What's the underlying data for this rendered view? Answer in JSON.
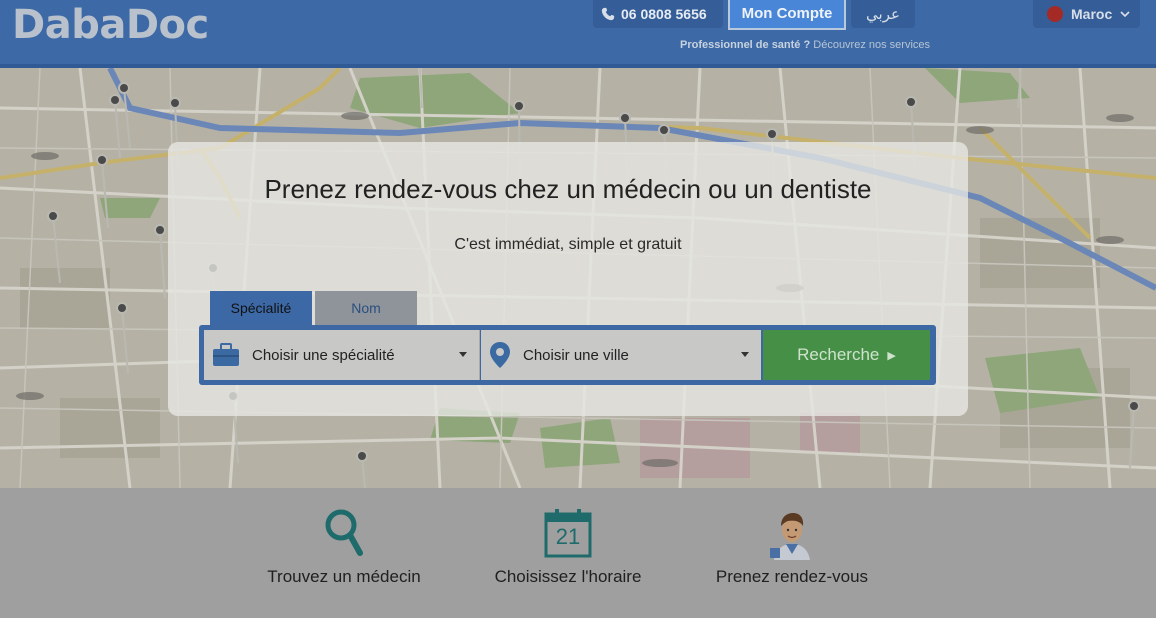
{
  "header": {
    "logo": "DabaDoc",
    "phone": "06 0808 5656",
    "account_label": "Mon Compte",
    "language_label": "عربي",
    "pro_bold": "Professionnel de santé ?",
    "pro_text": " Découvrez nos services",
    "country": "Maroc"
  },
  "hero": {
    "title": "Prenez rendez-vous chez un médecin ou un dentiste",
    "subtitle": "C'est immédiat, simple et gratuit"
  },
  "search": {
    "tabs": [
      {
        "label": "Spécialité",
        "active": true
      },
      {
        "label": "Nom",
        "active": false
      }
    ],
    "specialty_value": "Choisir une spécialité",
    "city_value": "Choisir une ville",
    "button_label": "Recherche"
  },
  "steps": [
    {
      "label": "Trouvez un médecin",
      "icon": "magnifier-icon"
    },
    {
      "label": "Choisissez l'horaire",
      "icon": "calendar-icon",
      "calendar_day": "21"
    },
    {
      "label": "Prenez rendez-vous",
      "icon": "doctor-icon"
    }
  ],
  "colors": {
    "header_bg": "#3d6aa6",
    "account_btn": "#4a86d8",
    "search_btn": "#459046",
    "icon_teal": "#1f6b6b"
  }
}
